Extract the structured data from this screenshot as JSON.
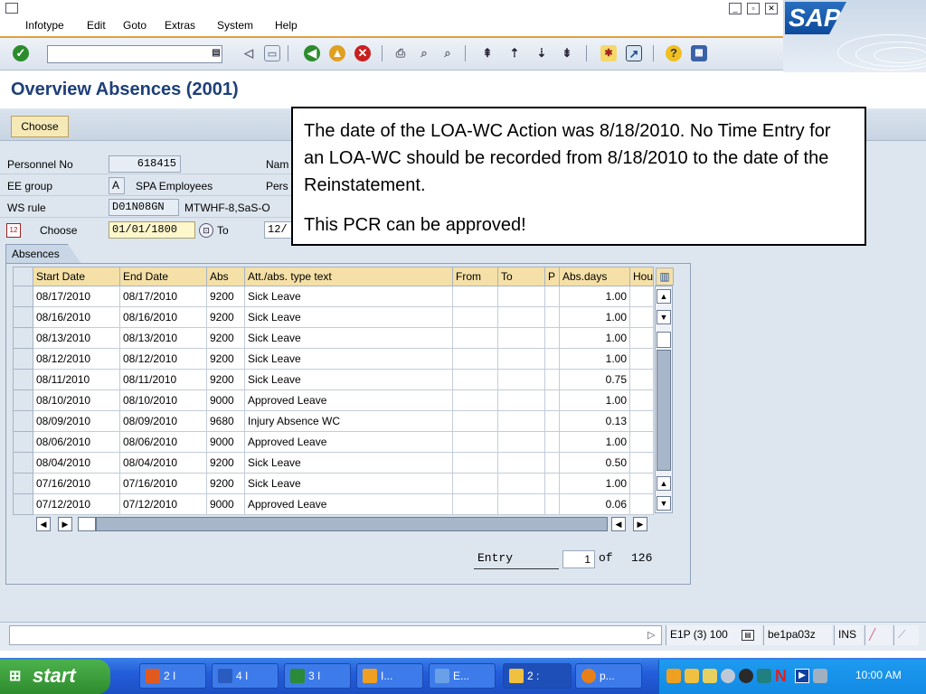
{
  "menu": {
    "items": [
      "Infotype",
      "Edit",
      "Goto",
      "Extras",
      "System",
      "Help"
    ]
  },
  "brand": {
    "logo_text": "SAP",
    "accent": "#e0a040"
  },
  "page": {
    "title": "Overview Absences (2001)"
  },
  "app_toolbar": {
    "choose_label": "Choose"
  },
  "header": {
    "personnel_no_label": "Personnel No",
    "personnel_no": "618415",
    "name_label": "Nam",
    "ee_group_label": "EE group",
    "ee_group_code": "A",
    "ee_group_text": "SPA Employees",
    "pers_label": "Pers",
    "ws_rule_label": "WS rule",
    "ws_rule_code": "D01N08GN",
    "ws_rule_text": "MTWHF-8,SaS-O",
    "choose_label": "Choose",
    "date_from": "01/01/1800",
    "to_label": "To",
    "date_to": "12/"
  },
  "tab": {
    "label": "Absences"
  },
  "table": {
    "columns": [
      "Start Date",
      "End Date",
      "Abs",
      "Att./abs. type text",
      "From",
      "To",
      "P",
      "Abs.days",
      "Hou"
    ],
    "rows": [
      [
        "08/17/2010",
        "08/17/2010",
        "9200",
        "Sick Leave",
        "",
        "",
        "",
        "1.00"
      ],
      [
        "08/16/2010",
        "08/16/2010",
        "9200",
        "Sick Leave",
        "",
        "",
        "",
        "1.00"
      ],
      [
        "08/13/2010",
        "08/13/2010",
        "9200",
        "Sick Leave",
        "",
        "",
        "",
        "1.00"
      ],
      [
        "08/12/2010",
        "08/12/2010",
        "9200",
        "Sick Leave",
        "",
        "",
        "",
        "1.00"
      ],
      [
        "08/11/2010",
        "08/11/2010",
        "9200",
        "Sick Leave",
        "",
        "",
        "",
        "0.75"
      ],
      [
        "08/10/2010",
        "08/10/2010",
        "9000",
        "Approved Leave",
        "",
        "",
        "",
        "1.00"
      ],
      [
        "08/09/2010",
        "08/09/2010",
        "9680",
        "Injury Absence WC",
        "",
        "",
        "",
        "0.13"
      ],
      [
        "08/06/2010",
        "08/06/2010",
        "9000",
        "Approved Leave",
        "",
        "",
        "",
        "1.00"
      ],
      [
        "08/04/2010",
        "08/04/2010",
        "9200",
        "Sick Leave",
        "",
        "",
        "",
        "0.50"
      ],
      [
        "07/16/2010",
        "07/16/2010",
        "9200",
        "Sick Leave",
        "",
        "",
        "",
        "1.00"
      ],
      [
        "07/12/2010",
        "07/12/2010",
        "9000",
        "Approved Leave",
        "",
        "",
        "",
        "0.06"
      ]
    ]
  },
  "entry": {
    "label": "Entry",
    "value": "1",
    "of_label": "of",
    "total": "126"
  },
  "callout": {
    "paragraph1": "The date of the LOA-WC Action was 8/18/2010.  No Time Entry for an LOA-WC should be recorded from 8/18/2010 to the date of the Reinstatement.",
    "paragraph2": "This PCR can be approved!"
  },
  "statusbar": {
    "system": "E1P (3) 100",
    "server": "be1pa03z",
    "mode": "INS"
  },
  "taskbar": {
    "start_label": "start",
    "tasks": [
      "2 I",
      "4 I",
      "3 I",
      "I...",
      "E...",
      "2 :",
      "p..."
    ],
    "clock": "10:00 AM"
  }
}
